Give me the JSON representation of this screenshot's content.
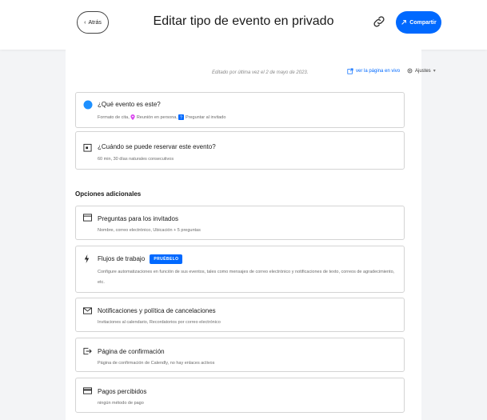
{
  "header": {
    "back_label": "Atrás",
    "title": "Editar tipo de evento en privado",
    "share_label": "Compartir"
  },
  "meta": {
    "edited": "Editado por última vez el 2 de mayo de 2023.",
    "live_link": "ver la página en vivo",
    "settings": "Ajustes"
  },
  "cards": {
    "what": {
      "title": "¿Qué evento es este?",
      "sub_prefix": "Formato de cita,",
      "location_in_person": "Reunión en persona,",
      "location_ask": "Preguntar al invitado"
    },
    "when": {
      "title": "¿Cuándo se puede reservar este evento?",
      "sub": "60 min, 30 días naturales consecutivos"
    }
  },
  "additional": {
    "heading": "Opciones adicionales",
    "questions": {
      "title": "Preguntas para los invitados",
      "sub": "Nombre, correo electrónico, Ubicación + 5 preguntas"
    },
    "workflows": {
      "title": "Flujos de trabajo",
      "badge": "PRUÉBELO",
      "sub": "Configure automatizaciones en función de sus eventos, tales como mensajes de correo electrónico y notificaciones de texto, correos de agradecimiento, etc."
    },
    "notifications": {
      "title": "Notificaciones y política de cancelaciones",
      "sub": "Invitaciones al calendario, Recordatorios por correo electrónico"
    },
    "confirmation": {
      "title": "Página de confirmación",
      "sub": "Página de confirmación de Calendly, no hay enlaces activos"
    },
    "payments": {
      "title": "Pagos percibidos",
      "sub": "ningún método de pago"
    }
  },
  "colors": {
    "accent": "#0069ff",
    "event_dot": "#1e90ff",
    "pin": "#d946ef",
    "ask_icon": "#0069ff"
  },
  "icons": [
    "chevron-left-icon",
    "link-icon",
    "share-icon",
    "external-link-icon",
    "gear-icon",
    "chevron-down-icon",
    "calendar-icon",
    "list-icon",
    "bolt-icon",
    "envelope-icon",
    "redirect-icon",
    "credit-card-icon",
    "location-pin-icon",
    "question-icon"
  ]
}
